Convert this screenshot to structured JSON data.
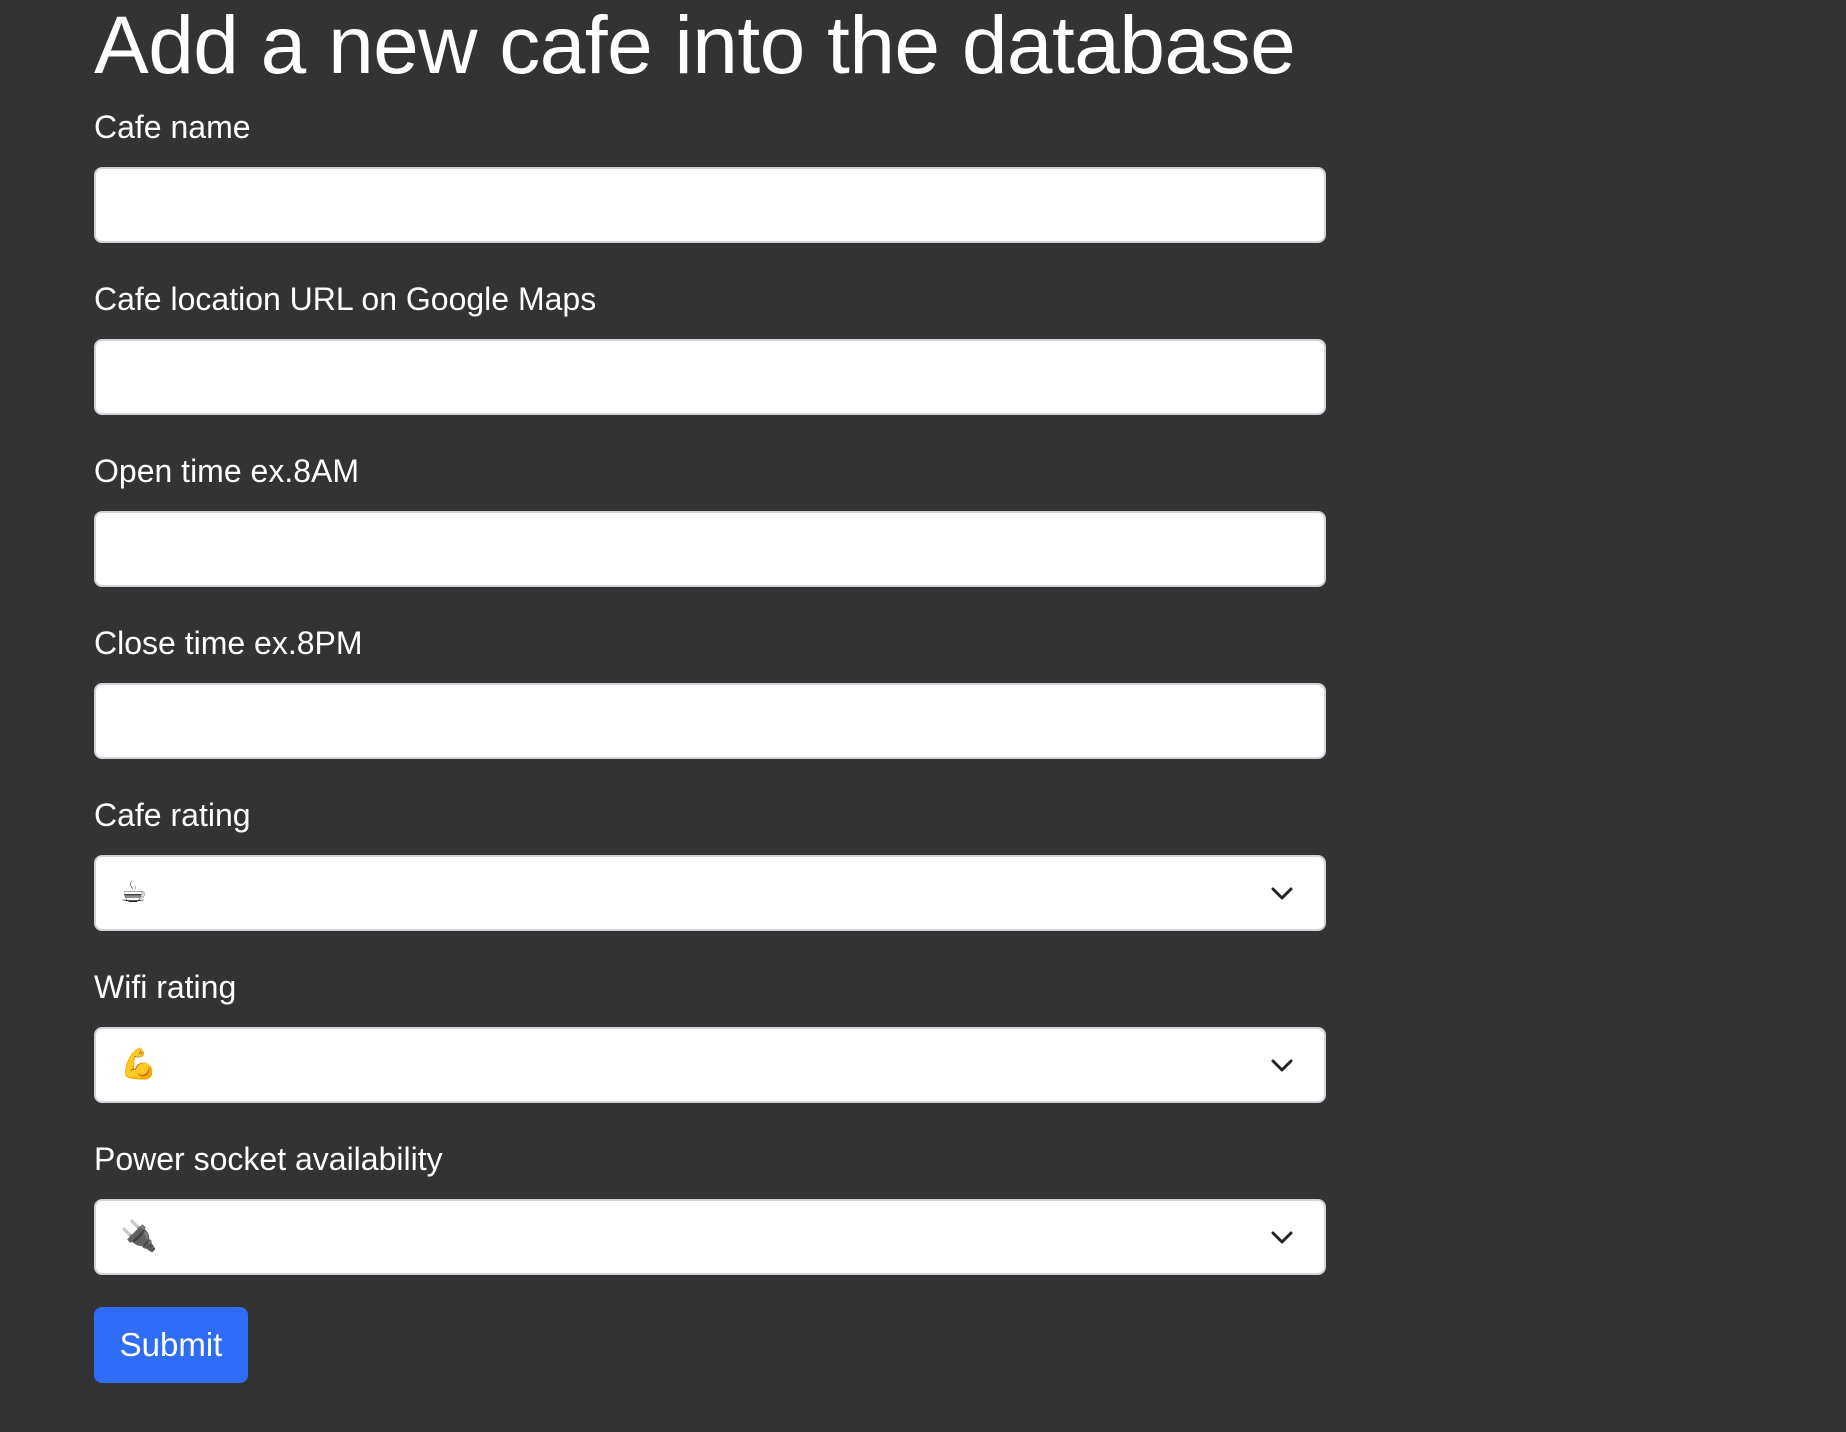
{
  "page": {
    "title": "Add a new cafe into the database"
  },
  "form": {
    "cafe_name": {
      "label": "Cafe name",
      "value": "",
      "placeholder": ""
    },
    "location_url": {
      "label": "Cafe location URL on Google Maps",
      "value": "",
      "placeholder": ""
    },
    "open_time": {
      "label": "Open time ex.8AM",
      "value": "",
      "placeholder": ""
    },
    "close_time": {
      "label": "Close time ex.8PM",
      "value": "",
      "placeholder": ""
    },
    "cafe_rating": {
      "label": "Cafe rating",
      "selected": "☕"
    },
    "wifi_rating": {
      "label": "Wifi rating",
      "selected": "💪"
    },
    "power_rating": {
      "label": "Power socket availability",
      "selected": "🔌"
    },
    "submit_label": "Submit"
  },
  "colors": {
    "background": "#333333",
    "text": "#ffffff",
    "input_border": "#ced4da",
    "primary_button": "#2f6df6"
  },
  "icons": {
    "dropdown": "chevron-down-icon"
  }
}
